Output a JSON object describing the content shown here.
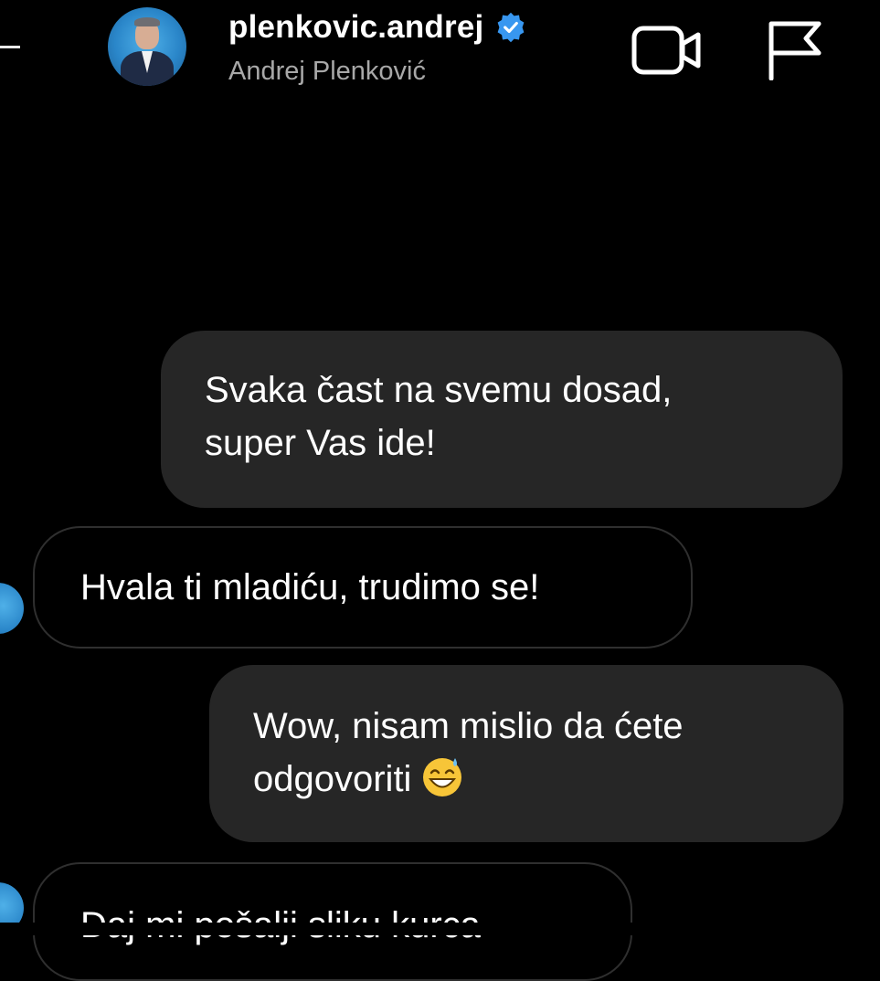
{
  "header": {
    "username": "plenkovic.andrej",
    "display_name": "Andrej Plenković",
    "verified": true,
    "accent_color": "#3897f0"
  },
  "icons": {
    "back": "back-arrow-icon",
    "video": "video-camera-icon",
    "flag": "flag-icon",
    "verified": "verified-badge-icon"
  },
  "messages": [
    {
      "from": "me",
      "line1": "Svaka čast na svemu dosad,",
      "line2": "super Vas ide!"
    },
    {
      "from": "them",
      "line1": "Hvala ti mladiću, trudimo se!"
    },
    {
      "from": "me",
      "line1": "Wow, nisam mislio da ćete",
      "line2": "odgovoriti",
      "emoji": "grinning-face-with-sweat"
    },
    {
      "from": "them",
      "line1": "Daj mi pošalji sliku kurca"
    }
  ]
}
